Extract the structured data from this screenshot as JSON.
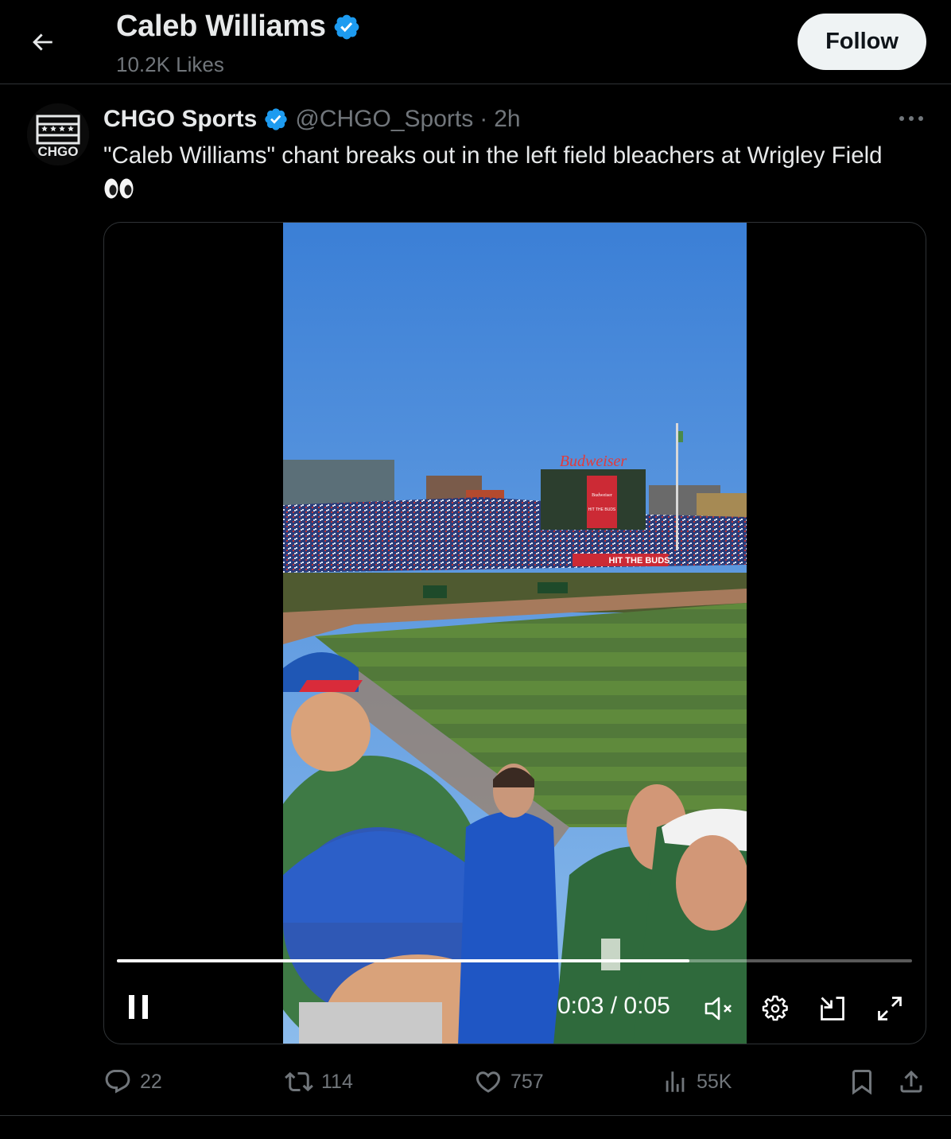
{
  "header": {
    "title": "Caleb Williams",
    "subtitle": "10.2K Likes",
    "follow_label": "Follow"
  },
  "post": {
    "avatar_text": "CHGO",
    "author_name": "CHGO Sports",
    "handle": "@CHGO_Sports",
    "separator": "·",
    "time": "2h",
    "text": "\"Caleb Williams\" chant breaks out in the left field bleachers at Wrigley Field",
    "emoji": "👀"
  },
  "video": {
    "elapsed": "0:03",
    "time_sep": " / ",
    "duration": "0:05",
    "progress": 0.72,
    "signage": {
      "scoreboard_brand": "Budweiser",
      "panel_brand": "Budweiser",
      "panel_text": "HIT THE BUDS",
      "banner_text": "HIT THE BUDS"
    }
  },
  "actions": {
    "replies": "22",
    "reposts": "114",
    "likes": "757",
    "views": "55K"
  },
  "colors": {
    "background": "#000000",
    "text": "#e7e9ea",
    "muted": "#71767b",
    "verified": "#1d9bf0",
    "border": "#2f3336"
  },
  "icons": [
    "back-arrow-icon",
    "verified-badge-icon",
    "more-icon",
    "pause-icon",
    "mute-icon",
    "settings-icon",
    "pip-icon",
    "fullscreen-icon",
    "reply-icon",
    "repost-icon",
    "like-icon",
    "views-icon",
    "bookmark-icon",
    "share-icon"
  ]
}
